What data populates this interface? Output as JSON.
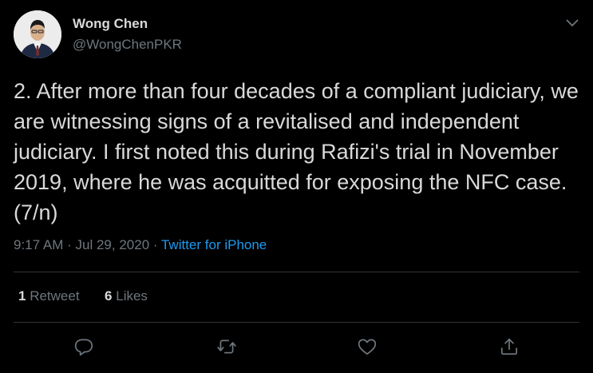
{
  "author": {
    "name": "Wong Chen",
    "handle": "@WongChenPKR"
  },
  "tweet": {
    "text": "2. After more than four decades of a compliant judiciary, we are witnessing signs of a revitalised and independent judiciary. I first noted this during Rafizi's trial in November 2019, where he was acquitted for exposing the NFC case. (7/n)",
    "time": "9:17 AM",
    "separator": "·",
    "date": "Jul 29, 2020",
    "source": "Twitter for iPhone"
  },
  "stats": {
    "retweets_count": "1",
    "retweets_label": "Retweet",
    "likes_count": "6",
    "likes_label": "Likes"
  },
  "icons": {
    "menu": "chevron-down-icon",
    "reply": "reply-icon",
    "retweet": "retweet-icon",
    "like": "heart-icon",
    "share": "share-icon"
  },
  "colors": {
    "background": "#000000",
    "text": "#d9d9d9",
    "secondary_text": "#6e767d",
    "link": "#1d9bf0",
    "divider": "#2f3336"
  }
}
